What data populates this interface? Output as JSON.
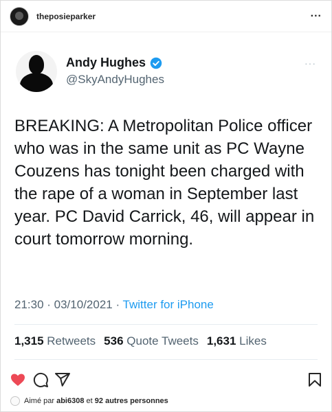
{
  "post": {
    "username": "theposieparker",
    "more_label": "..."
  },
  "tweet": {
    "author_name": "Andy Hughes",
    "author_handle": "@SkyAndyHughes",
    "more_label": "···",
    "text": "BREAKING: A Metropolitan Police officer who was in the same unit as PC Wayne Couzens has tonight been charged with the rape of a woman in September last year. PC David Carrick, 46, will appear in court tomorrow morning.",
    "time": "21:30 · 03/10/2021 ·",
    "source": "Twitter for iPhone",
    "stats": [
      {
        "count": "1,315",
        "label": "Retweets"
      },
      {
        "count": "536",
        "label": "Quote Tweets"
      },
      {
        "count": "1,631",
        "label": "Likes"
      }
    ],
    "verified_color": "#1d9bf0"
  },
  "likes": {
    "prefix": "Aimé par",
    "user": "abi6308",
    "connector": "et",
    "others": "92 autres personnes"
  },
  "icons": {
    "like": "heart-icon",
    "comment": "comment-icon",
    "share": "send-icon",
    "save": "bookmark-icon",
    "like_color": "#ed4956"
  }
}
